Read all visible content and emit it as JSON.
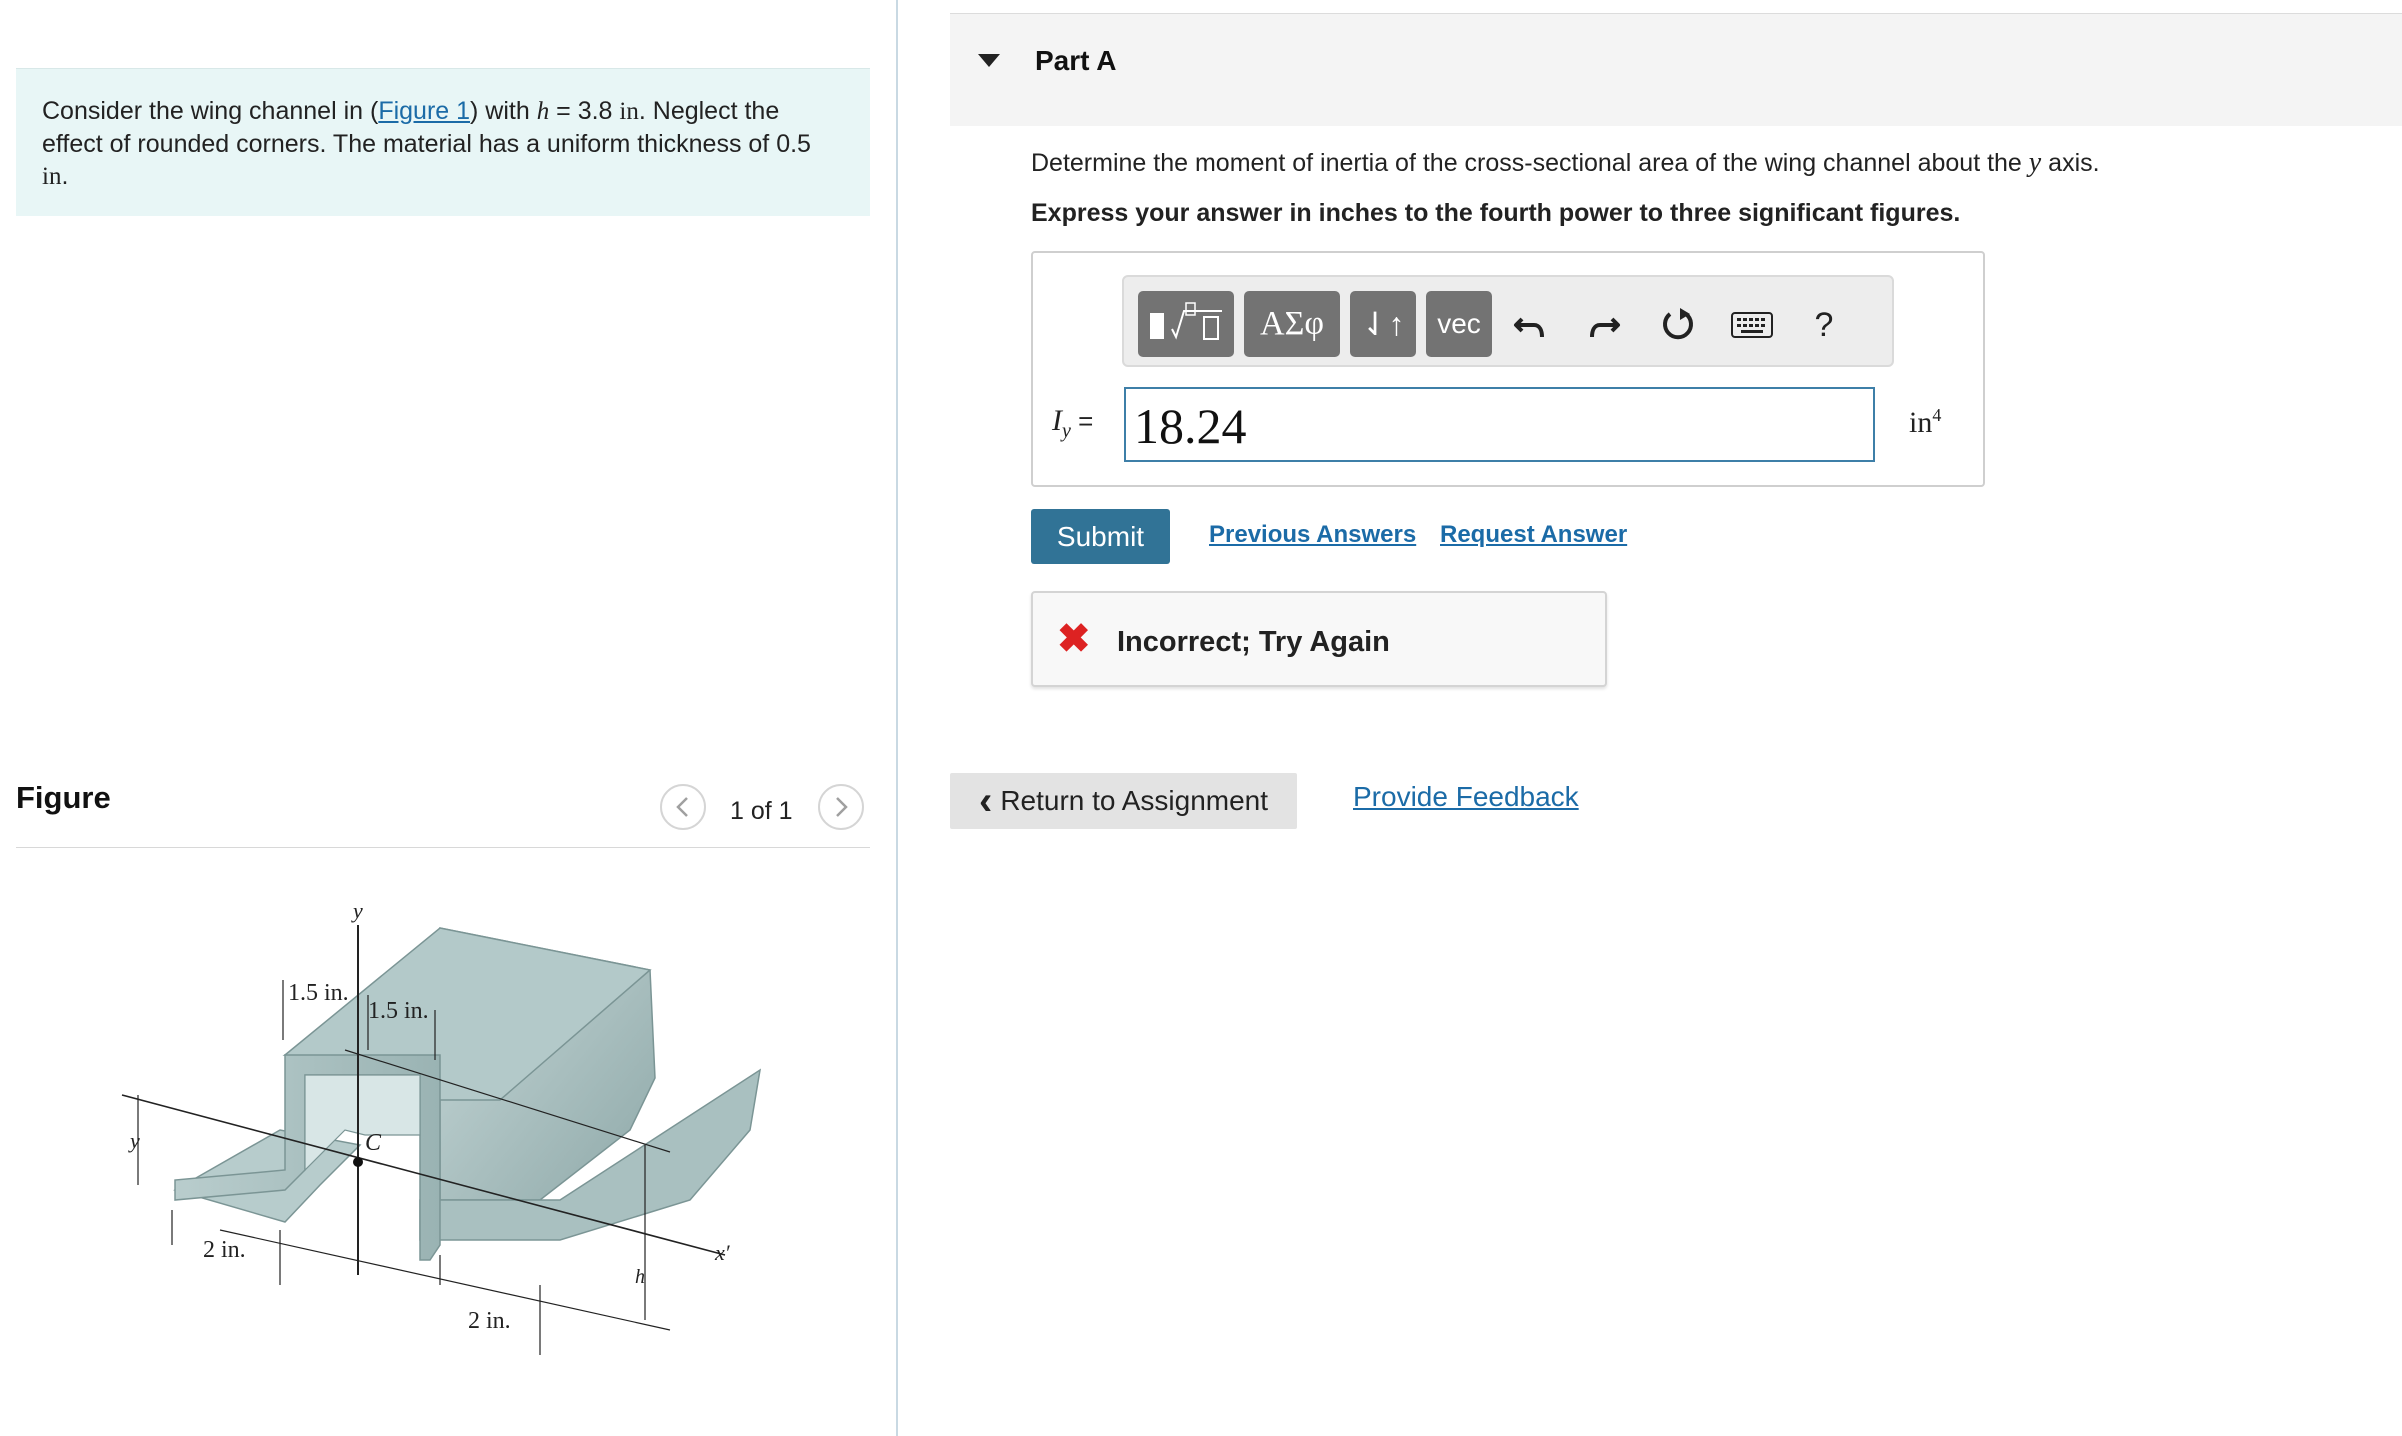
{
  "problem": {
    "text_before_link": "Consider the wing channel in (",
    "link": "Figure 1",
    "text_after_link": ") with ",
    "h_var": "h",
    "h_value": " = 3.8 ",
    "h_unit": "in",
    "sentence_rest": ". Neglect the effect of rounded corners. The material has a uniform thickness of ",
    "thickness": "0.5 ",
    "thickness_unit": "in",
    "end": "."
  },
  "figure": {
    "title": "Figure",
    "counter": "1 of 1",
    "prev_icon": "chevron-left-icon",
    "next_icon": "chevron-right-icon",
    "labels": {
      "y_axis": "y",
      "dim_1": "1.5 in.",
      "dim_2": "1.5 in.",
      "centroid": "C",
      "ybar": "y",
      "left_width": "2 in.",
      "bottom_width": "2 in.",
      "height": "h",
      "x_prime": "x′"
    }
  },
  "part": {
    "title": "Part A",
    "question_before": "Determine the moment of inertia of the cross-sectional area of the wing channel about the ",
    "question_var": "y",
    "question_after": " axis.",
    "instruction": "Express your answer in inches to the fourth power to three significant figures."
  },
  "toolbar": {
    "templates_icon": "templates-icon",
    "greek": "ΑΣφ",
    "arrows": "⇃↑",
    "vec": "vec",
    "undo_icon": "undo-icon",
    "redo_icon": "redo-icon",
    "reset_icon": "reset-icon",
    "keyboard_icon": "keyboard-icon",
    "help": "?"
  },
  "answer": {
    "label_main": "I",
    "label_sub": "y",
    "equals": " =",
    "value": "18.24",
    "unit_base": "in",
    "unit_exp": "4"
  },
  "actions": {
    "submit": "Submit",
    "previous_answers": "Previous Answers",
    "request_answer": "Request Answer"
  },
  "feedback": {
    "icon": "✖",
    "text": "Incorrect; Try Again"
  },
  "nav": {
    "return_icon": "‹",
    "return": "Return to Assignment",
    "provide_feedback": "Provide Feedback"
  },
  "colors": {
    "link": "#1b6ba7",
    "submit_bg": "#317396",
    "error": "#dd2222",
    "problem_bg": "#e8f6f6"
  }
}
